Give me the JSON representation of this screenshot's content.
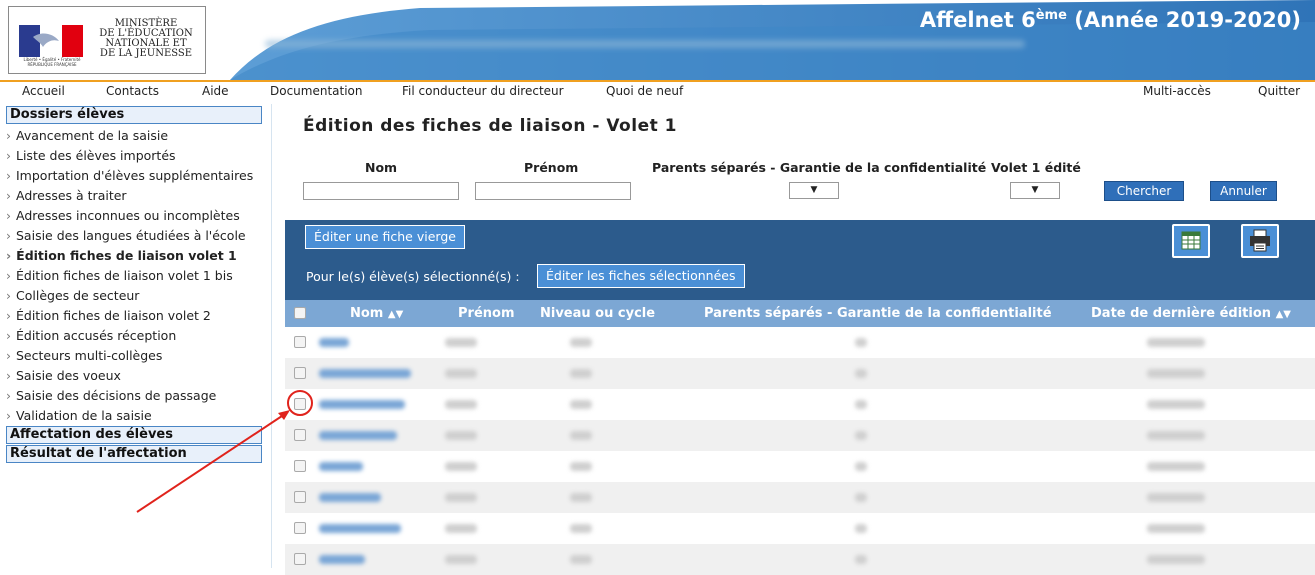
{
  "header": {
    "ministry_lines": [
      "MINISTÈRE",
      "DE L'ÉDUCATION",
      "NATIONALE ET",
      "DE LA JEUNESSE"
    ],
    "logo_motto": "Liberté • Égalité • Fraternité  RÉPUBLIQUE FRANÇAISE",
    "app_name": "Affelnet 6",
    "app_sup": "ème",
    "app_year": " (Année 2019-2020)",
    "band_color": "#3a7fc0"
  },
  "topnav": {
    "accueil": "Accueil",
    "contacts": "Contacts",
    "aide": "Aide",
    "documentation": "Documentation",
    "fil": "Fil conducteur du directeur",
    "quoi": "Quoi de neuf",
    "multi": "Multi-accès",
    "quitter": "Quitter"
  },
  "sidebar": {
    "section1": "Dossiers élèves",
    "items": [
      "Avancement de la saisie",
      "Liste des élèves importés",
      "Importation d'élèves supplémentaires",
      "Adresses à traiter",
      "Adresses inconnues ou incomplètes",
      "Saisie des langues étudiées à l'école",
      "Édition fiches de liaison volet 1",
      "Édition fiches de liaison volet 1 bis",
      "Collèges de secteur",
      "Édition fiches de liaison volet 2",
      "Édition accusés réception",
      "Secteurs multi-collèges",
      "Saisie des voeux",
      "Saisie des décisions de passage",
      "Validation de la saisie"
    ],
    "section2": "Affectation des élèves",
    "section3": "Résultat de l'affectation"
  },
  "main": {
    "title": "Édition des fiches de liaison - Volet 1",
    "filters": {
      "nom": "Nom",
      "prenom": "Prénom",
      "parents": "Parents séparés - Garantie de la confidentialité",
      "volet": "Volet 1 édité",
      "select_arrow": "▼",
      "search": "Chercher",
      "cancel": "Annuler"
    },
    "panel": {
      "blank_button": "Éditer une fiche vierge",
      "selected_label": "Pour le(s) élève(s) sélectionné(s) :",
      "selected_button": "Éditer les fiches sélectionnées",
      "excel_icon": "spreadsheet-icon",
      "print_icon": "printer-icon"
    },
    "table": {
      "headers": {
        "nom": "Nom",
        "prenom": "Prénom",
        "niveau": "Niveau ou cycle",
        "parents": "Parents séparés - Garantie de la confidentialité",
        "date": "Date de dernière édition"
      },
      "sort_icon": "▲▼"
    }
  }
}
